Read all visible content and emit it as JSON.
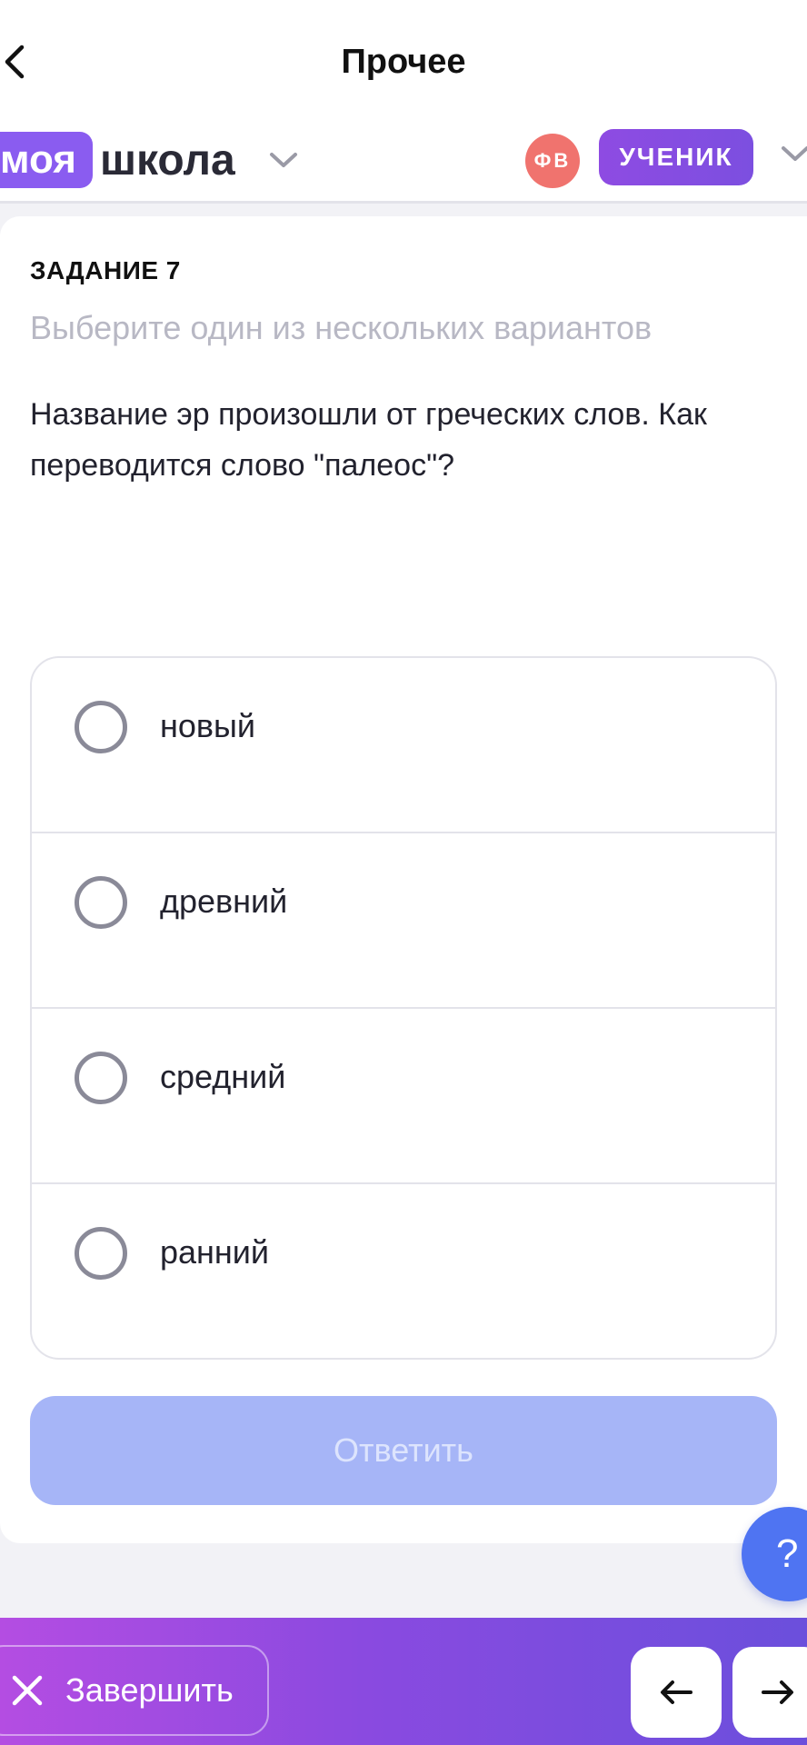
{
  "header": {
    "title": "Прочее"
  },
  "brand": {
    "part1": "моя",
    "part2": "школа"
  },
  "user": {
    "initials": "ФВ",
    "role": "УЧЕНИК"
  },
  "task": {
    "label": "ЗАДАНИЕ 7",
    "hint": "Выберите один из нескольких вариантов",
    "question": "Название эр произошли от греческих слов. Как переводится слово \"палеос\"?",
    "options": [
      {
        "label": "новый",
        "selected": false
      },
      {
        "label": "древний",
        "selected": false
      },
      {
        "label": "средний",
        "selected": false
      },
      {
        "label": "ранний",
        "selected": false
      }
    ],
    "answer_label": "Ответить"
  },
  "help": {
    "label": "?"
  },
  "footer": {
    "finish_label": "Завершить",
    "prev_icon": "arrow-left-icon",
    "next_icon": "arrow-right-icon"
  },
  "colors": {
    "accent": "#8a5cf0",
    "button_disabled": "#a6b5f7",
    "help": "#4f74f2",
    "avatar": "#f0736e"
  }
}
